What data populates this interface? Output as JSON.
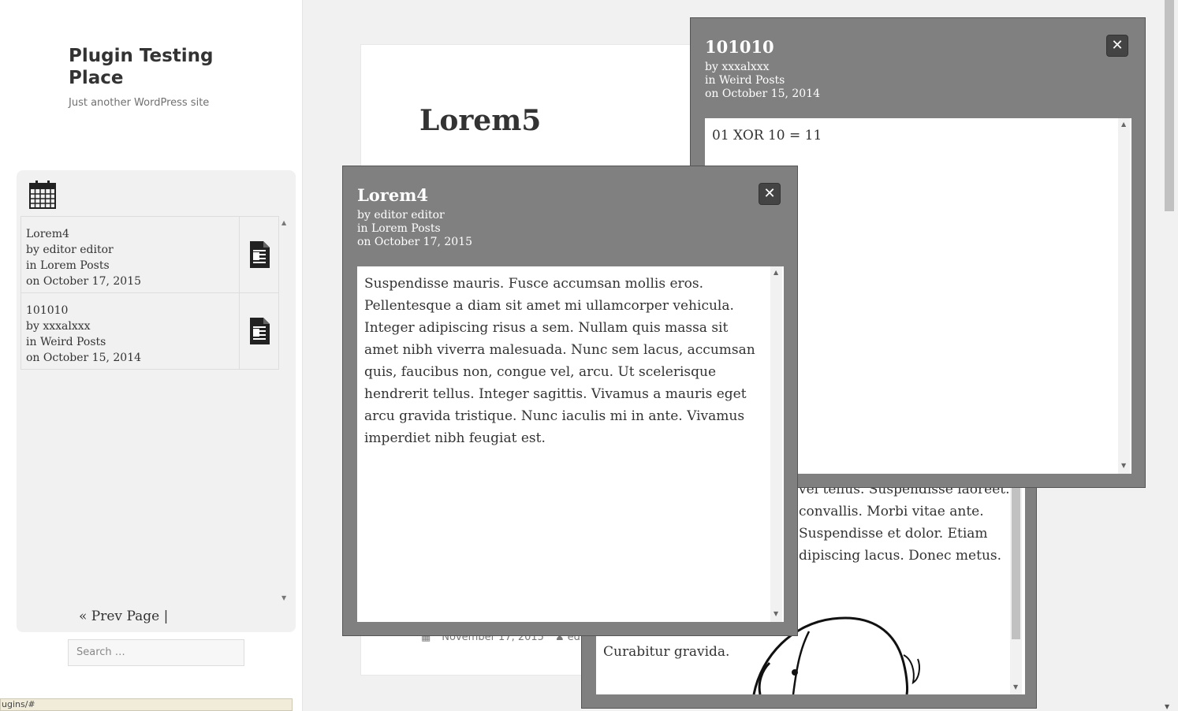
{
  "site": {
    "title": "Plugin Testing Place",
    "description": "Just another WordPress site"
  },
  "widget": {
    "calendar_icon": "calendar-icon",
    "posts": [
      {
        "title": "Lorem4",
        "author": "by editor editor",
        "category": "in Lorem Posts",
        "date": "on October 17, 2015",
        "icon": "document-icon"
      },
      {
        "title": "101010",
        "author": "by xxxalxxx",
        "category": "in Weird Posts",
        "date": "on October 15, 2014",
        "icon": "document-icon"
      }
    ],
    "prev_page": "« Prev Page |"
  },
  "search": {
    "placeholder": "Search …"
  },
  "statusbar": {
    "url": "ugins/#"
  },
  "article": {
    "title": "Lorem5",
    "date": "November 17, 2015",
    "author": "edit"
  },
  "modals": {
    "back": {
      "lines": [
        "vel tellus. Suspendisse laoreet.",
        "convallis. Morbi vitae ante.",
        "Suspendisse et dolor. Etiam",
        "dipiscing lacus. Donec metus."
      ],
      "curabitur": "Curabitur gravida."
    },
    "weird": {
      "title": "101010",
      "author": "by xxxalxxx",
      "category": "in Weird Posts",
      "date": "on October 15, 2014",
      "body": "01 XOR  10 = 11",
      "close": "✕"
    },
    "lorem4": {
      "title": "Lorem4",
      "author": "by editor editor",
      "category": "in Lorem Posts",
      "date": "on October 17, 2015",
      "body": "Suspendisse mauris. Fusce accumsan mollis eros. Pellentesque a diam sit amet mi ullamcorper vehicula. Integer adipiscing risus a sem. Nullam quis massa sit amet nibh viverra malesuada. Nunc sem lacus, accumsan quis, faucibus non, congue vel, arcu. Ut scelerisque hendrerit tellus. Integer sagittis. Vivamus a mauris eget arcu gravida tristique. Nunc iaculis mi in ante. Vivamus imperdiet nibh feugiat est.",
      "close": "✕"
    }
  }
}
